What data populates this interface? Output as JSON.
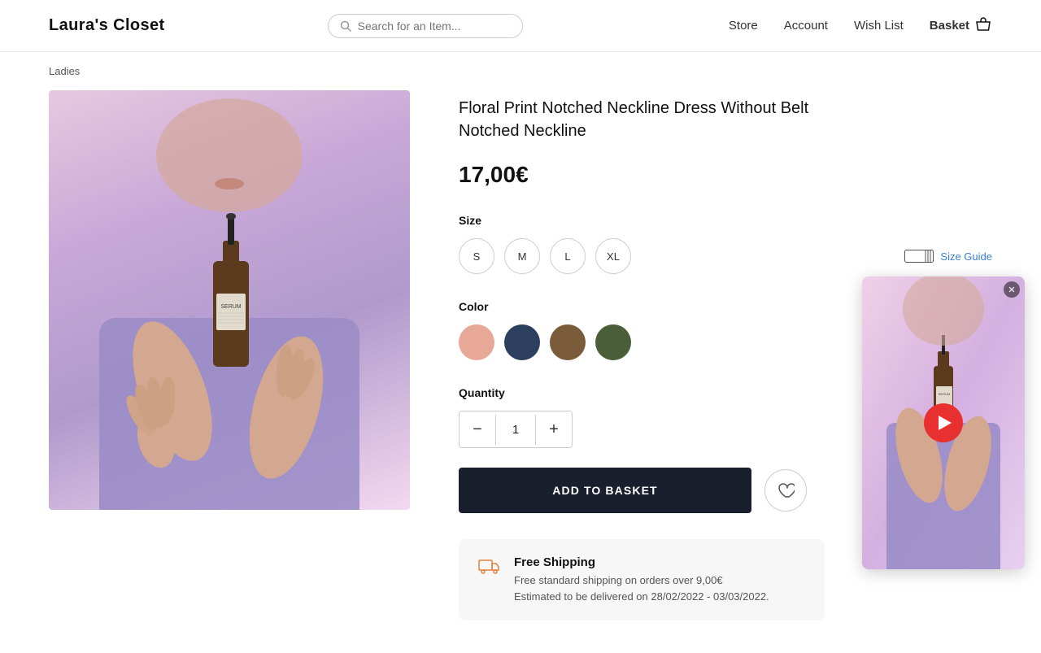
{
  "header": {
    "logo": "Laura's Closet",
    "search_placeholder": "Search for an Item...",
    "nav": {
      "store": "Store",
      "account": "Account",
      "wish_list": "Wish List",
      "basket": "Basket"
    }
  },
  "breadcrumb": "Ladies",
  "product": {
    "title": "Floral Print Notched Neckline Dress Without Belt Notched Neckline",
    "price": "17,00€",
    "size_label": "Size",
    "sizes": [
      "S",
      "M",
      "L",
      "XL"
    ],
    "size_guide_label": "Size Guide",
    "color_label": "Color",
    "colors": [
      {
        "name": "peach",
        "hex": "#E8A898"
      },
      {
        "name": "navy",
        "hex": "#2d3f5e"
      },
      {
        "name": "brown",
        "hex": "#7a5c3a"
      },
      {
        "name": "dark-green",
        "hex": "#4a5e3a"
      }
    ],
    "quantity_label": "Quantity",
    "quantity_value": "1",
    "add_to_basket_label": "ADD TO BASKET",
    "shipping": {
      "title": "Free Shipping",
      "description": "Free standard shipping on orders over 9,00€\nEstimated to be delivered on 28/02/2022 - 03/03/2022."
    }
  }
}
